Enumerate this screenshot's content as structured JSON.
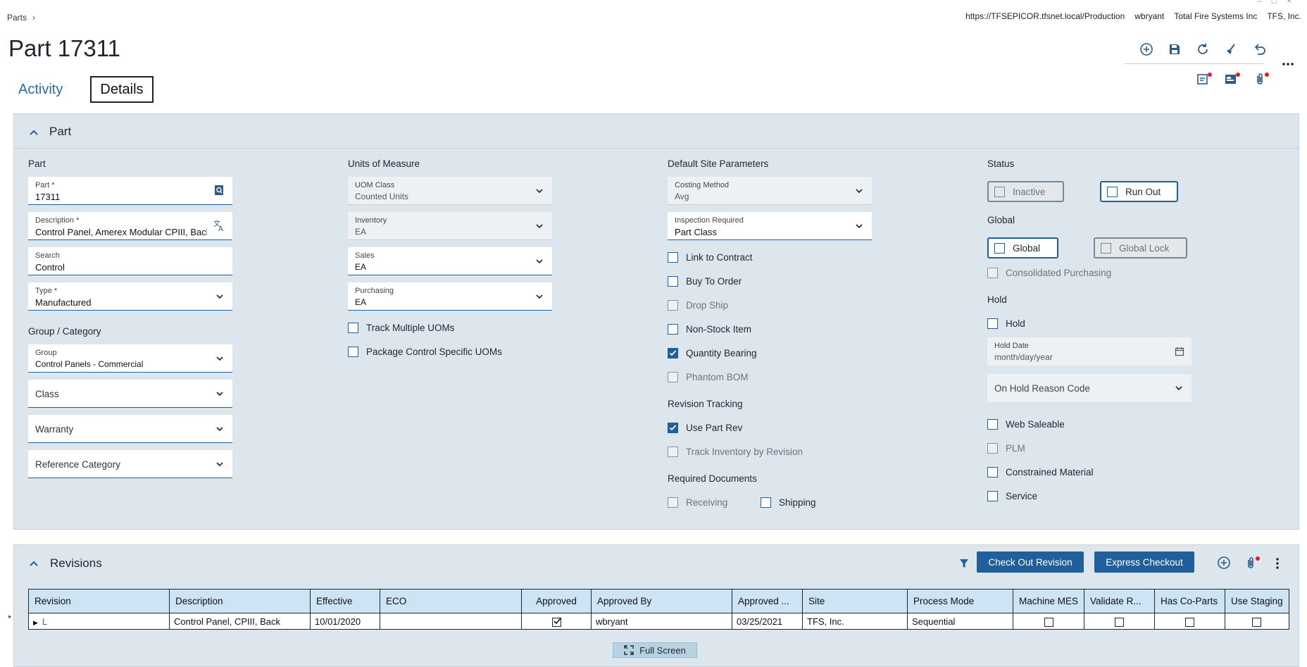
{
  "breadcrumb": {
    "root": "Parts",
    "sep": "›"
  },
  "userbar": {
    "url": "https://TFSEPICOR.tfsnet.local/Production",
    "user": "wbryant",
    "company": "Total Fire Systems Inc",
    "site": "TFS, Inc."
  },
  "page": {
    "title": "Part 17311"
  },
  "tabs": {
    "activity": "Activity",
    "details": "Details"
  },
  "toolbar": {
    "icons": [
      "add-new-icon",
      "save-icon",
      "refresh-icon",
      "clear-icon",
      "undo-icon",
      "more-icon",
      "notes-icon",
      "card-icon",
      "attachment-icon"
    ]
  },
  "part_panel": {
    "title": "Part",
    "col1": {
      "section_part": "Part",
      "part_label": "Part *",
      "part_value": "17311",
      "desc_label": "Description *",
      "desc_value": "Control Panel, Amerex Modular CPIII, Back",
      "search_label": "Search",
      "search_value": "Control",
      "type_label": "Type *",
      "type_value": "Manufactured",
      "section_group": "Group / Category",
      "group_label": "Group",
      "group_value": "Control Panels - Commercial",
      "class_placeholder": "Class",
      "warranty_placeholder": "Warranty",
      "refcat_placeholder": "Reference Category"
    },
    "col2": {
      "section": "Units of Measure",
      "uomclass_label": "UOM Class",
      "uomclass_value": "Counted Units",
      "inventory_label": "Inventory",
      "inventory_value": "EA",
      "sales_label": "Sales",
      "sales_value": "EA",
      "purchasing_label": "Purchasing",
      "purchasing_value": "EA",
      "track_multiple": "Track Multiple UOMs",
      "package_control": "Package Control Specific UOMs"
    },
    "col3": {
      "section": "Default Site Parameters",
      "costing_label": "Costing Method",
      "costing_value": "Avg",
      "inspection_label": "Inspection Required",
      "inspection_value": "Part Class",
      "link_contract": "Link to Contract",
      "buy_to_order": "Buy To Order",
      "drop_ship": "Drop Ship",
      "non_stock": "Non-Stock Item",
      "quantity_bearing": "Quantity Bearing",
      "phantom_bom": "Phantom BOM",
      "section_revision": "Revision Tracking",
      "use_part_rev": "Use Part Rev",
      "track_inv_rev": "Track Inventory by Revision",
      "section_docs": "Required Documents",
      "receiving": "Receiving",
      "shipping": "Shipping"
    },
    "col4": {
      "section_status": "Status",
      "inactive": "Inactive",
      "run_out": "Run Out",
      "section_global": "Global",
      "global": "Global",
      "global_lock": "Global Lock",
      "consolidated": "Consolidated Purchasing",
      "section_hold": "Hold",
      "hold": "Hold",
      "hold_date_label": "Hold Date",
      "hold_date_value": "month/day/year",
      "hold_reason_placeholder": "On Hold Reason Code",
      "web_saleable": "Web Saleable",
      "plm": "PLM",
      "constrained": "Constrained Material",
      "service": "Service"
    }
  },
  "revisions": {
    "title": "Revisions",
    "check_out": "Check Out Revision",
    "express_checkout": "Express Checkout",
    "columns": [
      "Revision",
      "Description",
      "Effective",
      "ECO",
      "Approved",
      "Approved By",
      "Approved ...",
      "Site",
      "Process Mode",
      "Machine MES",
      "Validate R...",
      "Has Co-Parts",
      "Use Staging"
    ],
    "rows": [
      {
        "revision": "L",
        "description": "Control Panel, CPIII, Back",
        "effective": "10/01/2020",
        "eco": "",
        "approved": true,
        "approved_by": "wbryant",
        "approved_date": "03/25/2021",
        "site": "TFS, Inc.",
        "process_mode": "Sequential",
        "machine_mes": false,
        "validate": false,
        "has_coparts": false,
        "use_staging": false
      }
    ],
    "full_screen": "Full Screen"
  }
}
